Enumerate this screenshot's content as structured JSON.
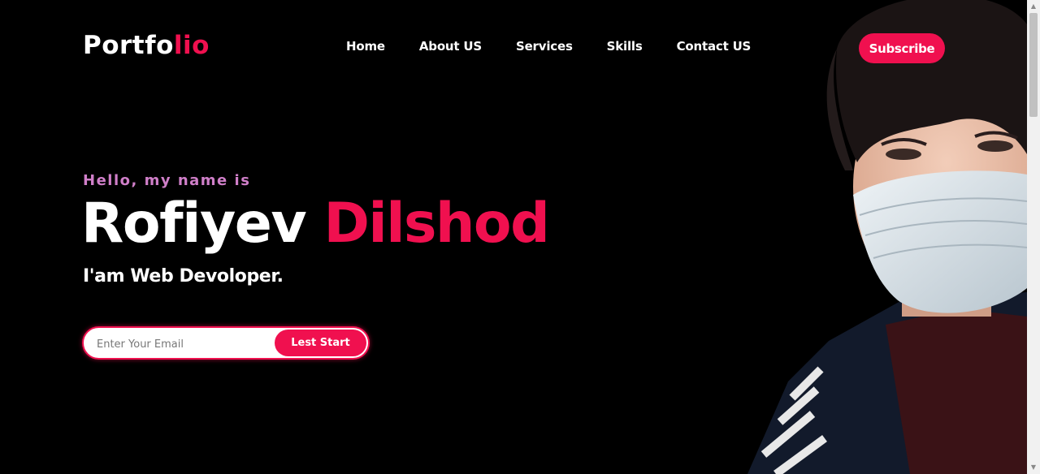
{
  "header": {
    "logo_main": "Portfo",
    "logo_accent": "lio",
    "nav": [
      "Home",
      "About US",
      "Services",
      "Skills",
      "Contact US"
    ],
    "subscribe_label": "Subscribe"
  },
  "hero": {
    "greeting": "Hello, my name is",
    "first_name": "Rofiyev",
    "last_name": "Dilshod",
    "role": "I'am Web Devoloper.",
    "email_placeholder": "Enter Your Email",
    "cta_label": "Lest Start"
  },
  "colors": {
    "accent": "#f0104f",
    "greeting": "#d07fc9",
    "background": "#000000"
  },
  "icons": {
    "scroll_up": "triangle-up-icon",
    "scroll_down": "triangle-down-icon"
  }
}
